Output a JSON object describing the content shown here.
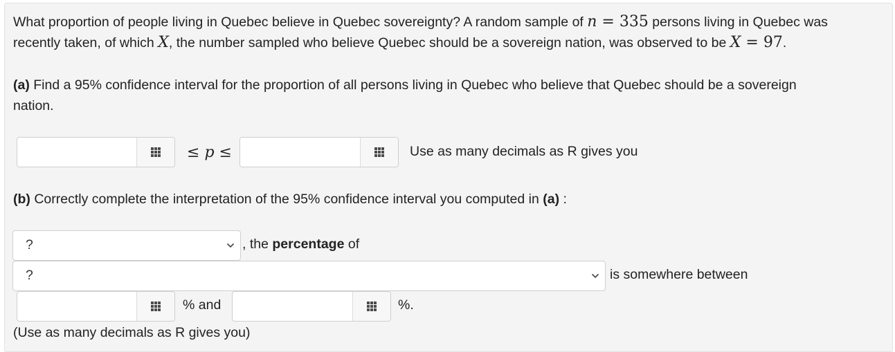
{
  "question": {
    "intro_1": "What proportion of people living in Quebec believe in Quebec sovereignty? A random sample of",
    "n_var": "n",
    "equals": "=",
    "n_value": "335",
    "intro_2": "persons living in Quebec was",
    "intro_3": "recently taken, of which",
    "x_var": "X",
    "intro_4": ", the number sampled who believe Quebec should be a sovereign nation, was observed to be",
    "x_value": "97",
    "period": "."
  },
  "part_a": {
    "label": "(a)",
    "text_1": "Find a 95% confidence interval for the proportion of all persons living in Quebec who believe that Quebec should be a sovereign",
    "text_2": "nation.",
    "lower_value": "",
    "upper_value": "",
    "leq": "≤",
    "p_var": "p",
    "hint": "Use as many decimals as R gives you"
  },
  "part_b": {
    "label": "(b)",
    "text": "Correctly complete the interpretation of the 95% confidence interval you computed in",
    "ref": "(a)",
    "colon": ":",
    "select_1": "?",
    "after_select_1_pre": ", the",
    "after_select_1_bold": "percentage",
    "after_select_1_post": "of",
    "select_2": "?",
    "after_select_2": "is somewhere between",
    "low_pct": "",
    "high_pct": "",
    "pct_and": "% and",
    "pct_end": "%.",
    "footer": "(Use as many decimals as R gives you)"
  }
}
